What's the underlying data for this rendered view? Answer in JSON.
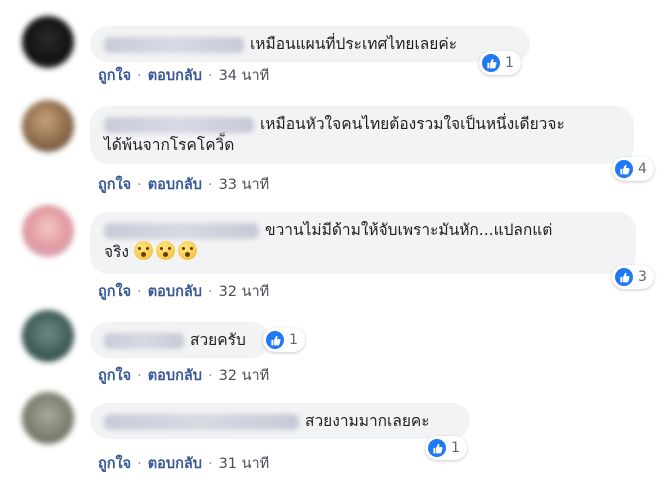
{
  "comments": [
    {
      "text": "เหมือนแผนที่ประเทศไทยเลยค่ะ",
      "like_label": "ถูกใจ",
      "reply_label": "ตอบกลับ",
      "time": "34 นาที",
      "reaction_count": "1"
    },
    {
      "text_line1": "เหมือนหัวใจคนไทยต้องรวมใจเป็นหนึ่งเดียวจะ",
      "text_line2": "ได้พ้นจากโรคโควิ็ด",
      "like_label": "ถูกใจ",
      "reply_label": "ตอบกลับ",
      "time": "33 นาที",
      "reaction_count": "4"
    },
    {
      "text_line1": "ขวานไม่มีด้ามให้จับเพราะมันหัก...แปลกแต่",
      "text_line2": "จริง",
      "like_label": "ถูกใจ",
      "reply_label": "ตอบกลับ",
      "time": "32 นาที",
      "reaction_count": "3"
    },
    {
      "text": "สวยครับ",
      "like_label": "ถูกใจ",
      "reply_label": "ตอบกลับ",
      "time": "32 นาที",
      "reaction_count": "1"
    },
    {
      "text": "สวยงามมากเลยคะ",
      "like_label": "ถูกใจ",
      "reply_label": "ตอบกลับ",
      "time": "31 นาที",
      "reaction_count": "1"
    }
  ],
  "separator": "·",
  "colors": {
    "bubble_bg": "#f2f3f5",
    "link": "#385898",
    "like_blue": "#2078f4",
    "meta_text": "#4b4f56"
  },
  "icons": {
    "reaction": "thumbs-up-icon",
    "emoji": "hushed-face-emoji-icon"
  }
}
